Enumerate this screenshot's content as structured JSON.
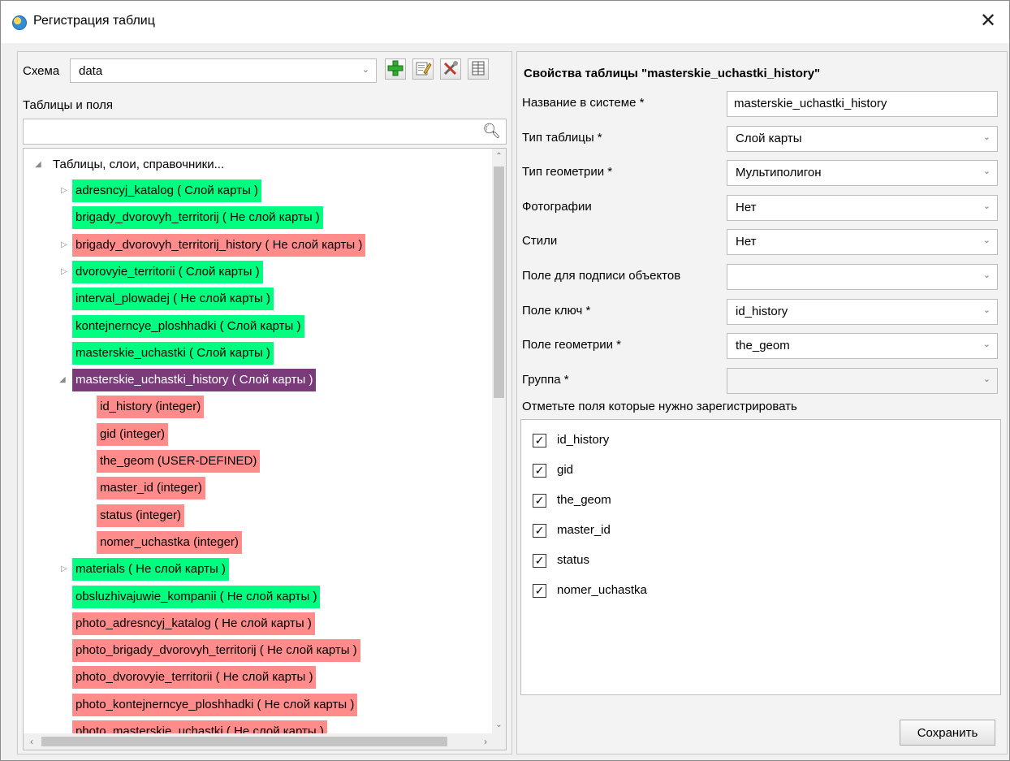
{
  "window": {
    "title": "Регистрация таблиц",
    "close": "✕"
  },
  "left": {
    "schema_label": "Схема",
    "schema_value": "data",
    "tables_label": "Таблицы и поля",
    "search_value": "",
    "tree": {
      "root": "Таблицы, слои, справочники...",
      "items": [
        {
          "text": "adresncyj_katalog  ( Слой карты )",
          "color": "g",
          "expander": "▷"
        },
        {
          "text": "brigady_dvorovyh_territorij  ( Не слой карты )",
          "color": "g",
          "expander": ""
        },
        {
          "text": "brigady_dvorovyh_territorij_history  ( Не слой карты )",
          "color": "r",
          "expander": "▷"
        },
        {
          "text": "dvorovyie_territorii  ( Слой карты )",
          "color": "g",
          "expander": "▷"
        },
        {
          "text": "interval_plowadej  ( Не слой карты )",
          "color": "g",
          "expander": ""
        },
        {
          "text": "kontejnerncye_ploshhadki  ( Слой карты )",
          "color": "g",
          "expander": ""
        },
        {
          "text": "masterskie_uchastki  ( Слой карты )",
          "color": "g",
          "expander": ""
        },
        {
          "text": "masterskie_uchastki_history  ( Слой карты )",
          "color": "sel",
          "expander": "◢"
        },
        {
          "text": "id_history (integer)",
          "color": "r",
          "child": true
        },
        {
          "text": "gid (integer)",
          "color": "r",
          "child": true
        },
        {
          "text": "the_geom (USER-DEFINED)",
          "color": "r",
          "child": true
        },
        {
          "text": "master_id (integer)",
          "color": "r",
          "child": true
        },
        {
          "text": "status (integer)",
          "color": "r",
          "child": true
        },
        {
          "text": "nomer_uchastka (integer)",
          "color": "r",
          "child": true
        },
        {
          "text": "materials  ( Не слой карты )",
          "color": "g",
          "expander": "▷"
        },
        {
          "text": "obsluzhivajuwie_kompanii  ( Не слой карты )",
          "color": "g",
          "expander": ""
        },
        {
          "text": "photo_adresncyj_katalog  ( Не слой карты )",
          "color": "r",
          "expander": ""
        },
        {
          "text": "photo_brigady_dvorovyh_territorij  ( Не слой карты )",
          "color": "r",
          "expander": ""
        },
        {
          "text": "photo_dvorovyie_territorii  ( Не слой карты )",
          "color": "r",
          "expander": ""
        },
        {
          "text": "photo_kontejnerncye_ploshhadki  ( Не слой карты )",
          "color": "r",
          "expander": ""
        },
        {
          "text": "photo_masterskie_uchastki  ( Не слой карты )",
          "color": "r",
          "expander": ""
        }
      ]
    }
  },
  "right": {
    "title": "Свойства таблицы \"masterskie_uchastki_history\"",
    "props": [
      {
        "label": "Название в системе *",
        "value": "masterskie_uchastki_history",
        "kind": "input"
      },
      {
        "label": "Тип таблицы *",
        "value": "Слой карты",
        "kind": "combo"
      },
      {
        "label": "Тип геометрии *",
        "value": "Мультиполигон",
        "kind": "combo"
      },
      {
        "label": "Фотографии",
        "value": "Нет",
        "kind": "combo"
      },
      {
        "label": "Стили",
        "value": "Нет",
        "kind": "combo"
      },
      {
        "label": "Поле для подписи объектов",
        "value": "",
        "kind": "combo"
      },
      {
        "label": "Поле ключ *",
        "value": "id_history",
        "kind": "combo"
      },
      {
        "label": "Поле геометрии *",
        "value": "the_geom",
        "kind": "combo"
      },
      {
        "label": "Группа *",
        "value": "",
        "kind": "combo-disabled"
      }
    ],
    "fields_label": "Отметьте поля которые нужно зарегистрировать",
    "fields": [
      "id_history",
      "gid",
      "the_geom",
      "master_id",
      "status",
      "nomer_uchastka"
    ],
    "save_label": "Сохранить"
  },
  "colors": {
    "green": "#00ff80",
    "red": "#ff8b8b",
    "selected": "#7b3b7a"
  }
}
